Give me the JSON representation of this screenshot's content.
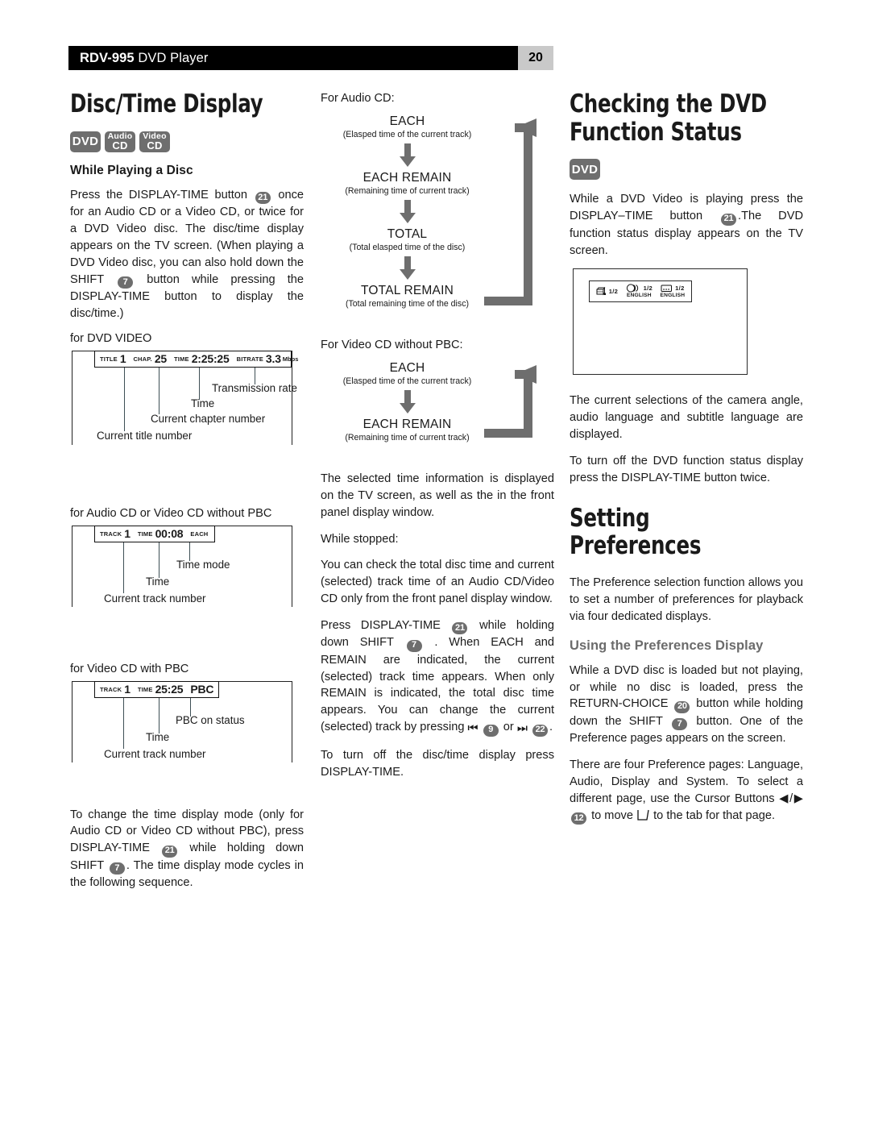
{
  "header": {
    "model": "RDV-995",
    "product": " DVD Player",
    "page_number": "20"
  },
  "col1": {
    "title": "Disc/Time Display",
    "badges": [
      {
        "name": "dvd-badge",
        "lines": [
          "DVD"
        ]
      },
      {
        "name": "audio-cd-badge",
        "lines": [
          "Audio",
          "CD"
        ]
      },
      {
        "name": "video-cd-badge",
        "lines": [
          "Video",
          "CD"
        ]
      }
    ],
    "subhead": "While Playing a Disc",
    "para1_a": "Press the DISPLAY-TIME button",
    "btn_21": "21",
    "para1_b": "once for an Audio CD or a Video CD, or twice for a DVD Video disc. The disc/time display appears on the TV screen. (When playing a DVD Video disc, you can also hold down the SHIFT",
    "btn_7": "7",
    "para1_c": "button while pressing the DISPLAY-TIME button to display the disc/time.)",
    "fig_dvd": {
      "caption": "for DVD VIDEO",
      "fields": [
        {
          "label": "TITLE",
          "value": "1"
        },
        {
          "label": "CHAP.",
          "value": "25"
        },
        {
          "label": "TIME",
          "value": "2:25:25"
        },
        {
          "label": "BITRATE",
          "value": "3.3",
          "unit": "Mbps"
        }
      ],
      "leaders": [
        "Transmission rate",
        "Time",
        "Current chapter number",
        "Current title number"
      ]
    },
    "fig_acd": {
      "caption": "for Audio CD or Video CD without PBC",
      "fields": [
        {
          "label": "TRACK",
          "value": "1"
        },
        {
          "label": "TIME",
          "value": "00:08"
        },
        {
          "label": "EACH",
          "value": ""
        }
      ],
      "leaders": [
        "Time mode",
        "Time",
        "Current track number"
      ]
    },
    "fig_vcd": {
      "caption": "for Video CD with PBC",
      "fields": [
        {
          "label": "TRACK",
          "value": "1"
        },
        {
          "label": "TIME",
          "value": "25:25"
        },
        {
          "label": "",
          "value": "PBC"
        }
      ],
      "leaders": [
        "PBC on status",
        "Time",
        "Current track number"
      ]
    },
    "para2_a": "To change the time display mode (only for Audio CD or Video CD without PBC), press DISPLAY-TIME",
    "para2_b": "while holding down SHIFT",
    "para2_c": ". The time display mode cycles in the following sequence."
  },
  "col2": {
    "flow_audio": {
      "caption": "For Audio CD:",
      "steps": [
        {
          "title": "EACH",
          "desc": "(Elasped time of the current track)"
        },
        {
          "title": "EACH REMAIN",
          "desc": "(Remaining time of current track)"
        },
        {
          "title": "TOTAL",
          "desc": "(Total elasped time of the disc)"
        },
        {
          "title": "TOTAL REMAIN",
          "desc": "(Total remaining time of the disc)"
        }
      ]
    },
    "flow_vcd": {
      "caption": "For Video CD without PBC:",
      "steps": [
        {
          "title": "EACH",
          "desc": "(Elasped time of the current track)"
        },
        {
          "title": "EACH REMAIN",
          "desc": "(Remaining time of current track)"
        }
      ]
    },
    "para1": "The selected time information is displayed on the TV screen, as well as the in the front panel display window.",
    "para2": "While stopped:",
    "para3": "You can check the total disc time and current (selected) track time of an Audio CD/Video CD only from the front panel display window.",
    "para4_a": "Press DISPLAY-TIME",
    "btn_21": "21",
    "para4_b": "while holding down SHIFT",
    "btn_7": "7",
    "para4_c": ". When EACH and REMAIN are indicated, the current (selected) track time appears. When only REMAIN is indicated, the total disc time appears. You can change the current (selected) track by pressing",
    "icon_prev": "⏮",
    "btn_9": "9",
    "or_text": "or",
    "icon_next": "⏭",
    "btn_22": "22",
    "para4_d": ".",
    "para5": "To turn off the disc/time display press DISPLAY-TIME."
  },
  "col3": {
    "title": "Checking the DVD\nFunction Status",
    "badges": [
      {
        "name": "dvd-badge",
        "lines": [
          "DVD"
        ]
      }
    ],
    "para1_a": "While a DVD Video is playing press the DISPLAY–TIME button",
    "btn_21": "21",
    "para1_b": ".The DVD function status display appears on the TV screen.",
    "tv_screen": {
      "indicators": [
        {
          "icon": "camera-angle-icon",
          "frac": "1/2",
          "lang": ""
        },
        {
          "icon": "audio-language-icon",
          "frac": "1/2",
          "lang": "ENGLISH"
        },
        {
          "icon": "subtitle-icon",
          "frac": "1/2",
          "lang": "ENGLISH"
        }
      ]
    },
    "para2": "The current selections of the camera angle, audio language and subtitle language are displayed.",
    "para3": "To turn off the DVD function status display press the DISPLAY-TIME button twice.",
    "title2": "Setting Preferences",
    "para4": "The Preference selection function allows you to set a number of preferences for playback via four dedicated displays.",
    "subhead2": "Using the Preferences Display",
    "para5_a": "While a DVD disc is loaded but not playing, or while no disc is loaded, press the RETURN-CHOICE",
    "btn_20": "20",
    "para5_b": "button while holding down the SHIFT",
    "btn_7": "7",
    "para5_c": "button. One of the Preference pages appears on the screen.",
    "para6_a": "There are four Preference pages: Language, Audio, Display and System. To select a different page, use the Cursor Buttons ◀/▶",
    "btn_12": "12",
    "para6_b": "to move",
    "para6_c": "to the tab for that page."
  },
  "colors": {
    "badge_gray": "#6e6e6e",
    "header_black": "#000000",
    "page_num_gray": "#c9c9c9",
    "arrow_gray": "#6e6e6e",
    "leader_teal": "#3e4f55",
    "subhead_gray": "#6b6b6b"
  }
}
